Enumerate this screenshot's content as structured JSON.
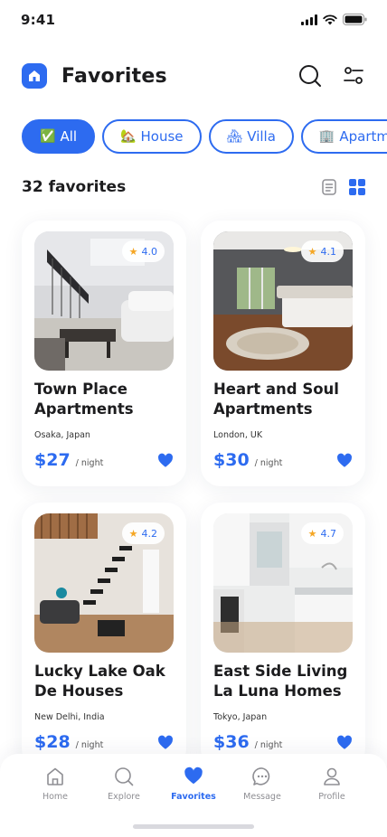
{
  "status": {
    "time": "9:41"
  },
  "header": {
    "title": "Favorites"
  },
  "filters": [
    {
      "label": "All",
      "emoji": "✅",
      "active": true
    },
    {
      "label": "House",
      "emoji": "🏡",
      "active": false
    },
    {
      "label": "Villa",
      "emoji": "🏘",
      "active": false
    },
    {
      "label": "Apartm",
      "emoji": "🏢",
      "active": false
    }
  ],
  "summary": {
    "count_label": "32 favorites"
  },
  "listings": [
    {
      "title": "Town Place Apartments",
      "location": "Osaka, Japan",
      "price": "$27",
      "per": "/ night",
      "rating": "4.0"
    },
    {
      "title": "Heart and Soul Apartments",
      "location": "London, UK",
      "price": "$30",
      "per": "/ night",
      "rating": "4.1"
    },
    {
      "title": "Lucky Lake Oak De  Houses",
      "location": "New Delhi, India",
      "price": "$28",
      "per": "/ night",
      "rating": "4.2"
    },
    {
      "title": "East Side Living La Luna Homes",
      "location": "Tokyo, Japan",
      "price": "$36",
      "per": "/ night",
      "rating": "4.7"
    }
  ],
  "nav": [
    {
      "label": "Home",
      "icon": "home-icon",
      "active": false
    },
    {
      "label": "Explore",
      "icon": "search-icon",
      "active": false
    },
    {
      "label": "Favorites",
      "icon": "heart-icon",
      "active": true
    },
    {
      "label": "Message",
      "icon": "chat-icon",
      "active": false
    },
    {
      "label": "Profile",
      "icon": "profile-icon",
      "active": false
    }
  ],
  "colors": {
    "accent": "#2d6bf0",
    "star": "#f5a623",
    "muted": "#8e8e93"
  }
}
